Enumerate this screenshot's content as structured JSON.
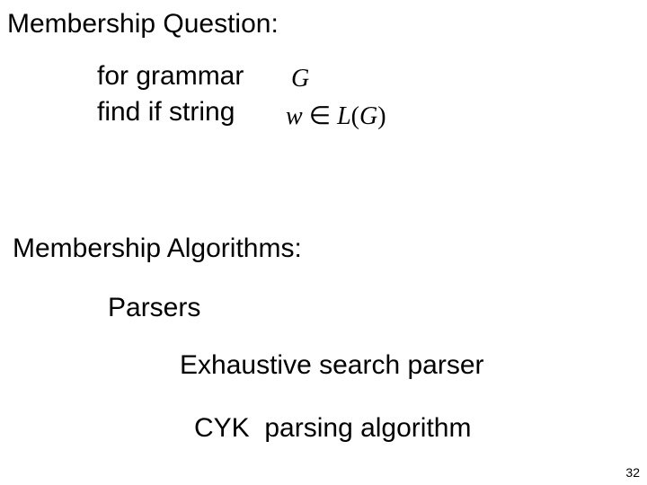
{
  "heading1": "Membership Question:",
  "line_for": "for grammar",
  "line_find": "find if string",
  "math": {
    "G": "G",
    "w": "w",
    "in": "∈",
    "L": "L",
    "open": "(",
    "G2": "G",
    "close": ")"
  },
  "heading2": "Membership Algorithms:",
  "parsers": "Parsers",
  "exhaustive": "Exhaustive search parser",
  "cyk": "CYK  parsing algorithm",
  "page_number": "32"
}
